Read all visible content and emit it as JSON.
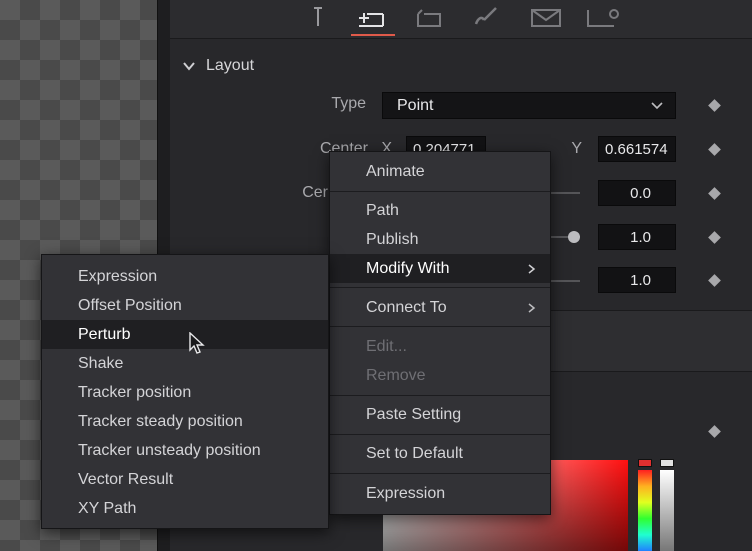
{
  "layout_section": {
    "title": "Layout",
    "type_label": "Type",
    "type_value": "Point",
    "center_label": "Center",
    "center_x_label": "X",
    "center_x_value": "0.204771",
    "center_y_label": "Y",
    "center_y_value": "0.661574",
    "row2_label": "Cer",
    "row2_value": "0.0",
    "row3_value": "1.0",
    "row4_value": "1.0"
  },
  "context_menu": {
    "items": [
      {
        "label": "Animate",
        "disabled": false
      },
      {
        "label": "Path",
        "disabled": false
      },
      {
        "label": "Publish",
        "disabled": false
      },
      {
        "label": "Modify With",
        "disabled": false,
        "submenu": true,
        "highlighted": true
      },
      {
        "label": "Connect To",
        "disabled": false,
        "submenu": true
      },
      {
        "label": "Edit...",
        "disabled": true
      },
      {
        "label": "Remove",
        "disabled": true
      },
      {
        "label": "Paste Setting",
        "disabled": false
      },
      {
        "label": "Set to Default",
        "disabled": false
      },
      {
        "label": "Expression",
        "disabled": false
      }
    ]
  },
  "modify_with_menu": {
    "items": [
      {
        "label": "Expression"
      },
      {
        "label": "Offset Position"
      },
      {
        "label": "Perturb",
        "highlighted": true
      },
      {
        "label": "Shake"
      },
      {
        "label": "Tracker position"
      },
      {
        "label": "Tracker steady position"
      },
      {
        "label": "Tracker unsteady position"
      },
      {
        "label": "Vector Result"
      },
      {
        "label": "XY Path"
      }
    ]
  },
  "colors": {
    "accent": "#e05a4a",
    "menu_bg": "#323236",
    "menu_hover": "#1f1f22",
    "field_bg": "#121214"
  }
}
